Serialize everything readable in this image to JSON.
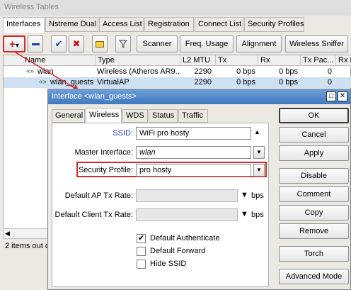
{
  "window": {
    "title": "Wireless Tables"
  },
  "main_tabs": [
    "Interfaces",
    "Nstreme Dual",
    "Access List",
    "Registration",
    "Connect List",
    "Security Profiles"
  ],
  "toolbar": {
    "add_icon": "+",
    "dropdown_icon": "▾",
    "scanner": "Scanner",
    "freq_usage": "Freq. Usage",
    "alignment": "Alignment",
    "wireless_sniffer": "Wireless Sniffer"
  },
  "table": {
    "columns": [
      "Name",
      "Type",
      "L2 MTU",
      "Tx",
      "Rx",
      "Tx Pac...",
      "Rx P"
    ],
    "rows": [
      {
        "name": "wlan",
        "type": "Wireless (Atheros AR9...",
        "l2mtu": "2290",
        "tx": "0 bps",
        "rx": "0 bps",
        "txpac": "0"
      },
      {
        "name": "wlan_guests",
        "type": "VirtualAP",
        "l2mtu": "2290",
        "tx": "0 bps",
        "rx": "0 bps",
        "txpac": "0"
      }
    ]
  },
  "status_bar": {
    "text": "2 items out o"
  },
  "dialog": {
    "title": "Interface <wlan_guests>",
    "tabs": [
      "General",
      "Wireless",
      "WDS",
      "Status",
      "Traffic"
    ],
    "fields": {
      "ssid": {
        "label": "SSID:",
        "value": "WiFi pro hosty"
      },
      "master_interface": {
        "label": "Master Interface:",
        "value": "wlan"
      },
      "security_profile": {
        "label": "Security Profile:",
        "value": "pro hosty"
      },
      "default_ap_tx_rate": {
        "label": "Default AP Tx Rate:",
        "value": "",
        "unit": "bps"
      },
      "default_client_tx_rate": {
        "label": "Default Client Tx Rate:",
        "value": "",
        "unit": "bps"
      }
    },
    "checkboxes": {
      "default_authenticate": {
        "label": "Default Authenticate",
        "checked": true
      },
      "default_forward": {
        "label": "Default Forward",
        "checked": false
      },
      "hide_ssid": {
        "label": "Hide SSID",
        "checked": false
      }
    },
    "buttons": [
      "OK",
      "Cancel",
      "Apply",
      "Disable",
      "Comment",
      "Copy",
      "Remove",
      "Torch",
      "Advanced Mode"
    ]
  },
  "colors": {
    "highlight": "#d42a2a",
    "titlebar": "#3f78bd",
    "selected_row": "#cfe0f3"
  }
}
